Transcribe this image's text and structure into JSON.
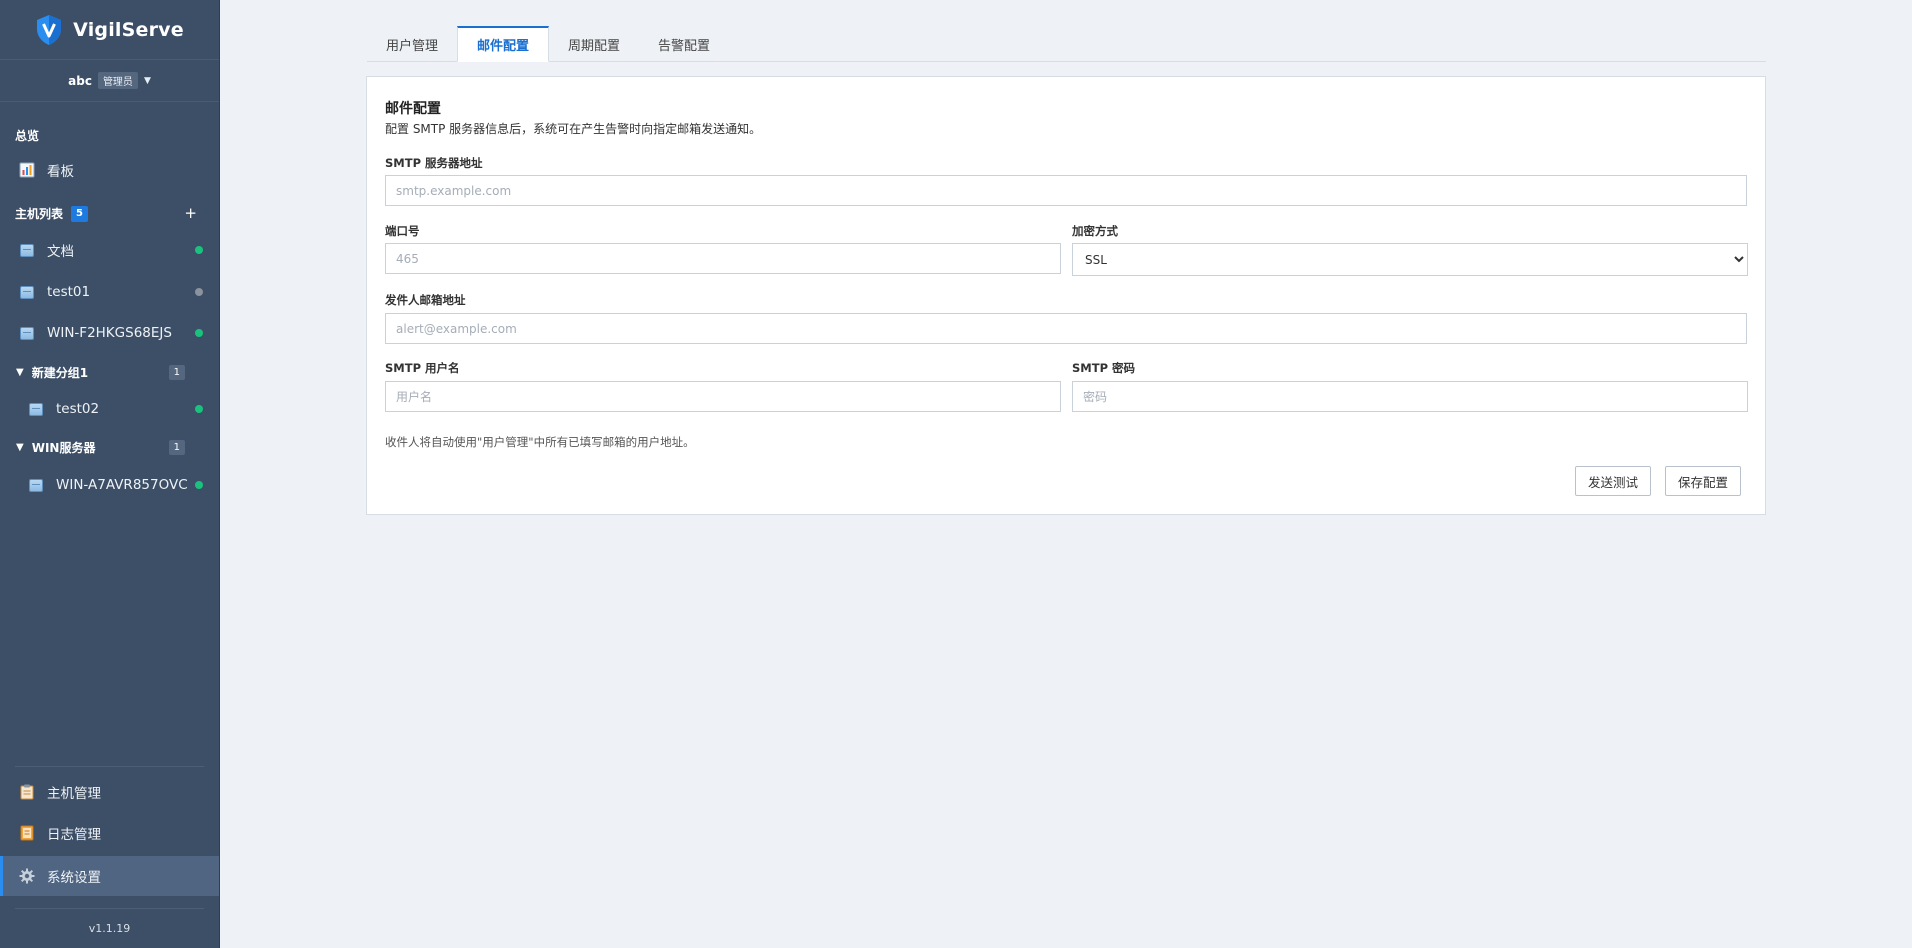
{
  "brand": {
    "name": "VigilServe",
    "color": "#2a8ef0"
  },
  "user": {
    "name": "abc",
    "role": "管理员",
    "menu_icon": "caret-down-icon"
  },
  "sidebar": {
    "overview_label": "总览",
    "dashboard": {
      "label": "看板",
      "icon": "chart-icon"
    },
    "host_list_label": "主机列表",
    "host_count": "5",
    "add_symbol": "+",
    "hosts": [
      {
        "name": "文档",
        "status": "online"
      },
      {
        "name": "test01",
        "status": "offline"
      },
      {
        "name": "WIN-F2HKGS68EJS",
        "status": "online"
      }
    ],
    "groups": [
      {
        "name": "新建分组1",
        "count": "1",
        "hosts": [
          {
            "name": "test02",
            "status": "online"
          }
        ]
      },
      {
        "name": "WIN服务器",
        "count": "1",
        "hosts": [
          {
            "name": "WIN-A7AVR857OVC",
            "status": "online"
          }
        ]
      }
    ],
    "bottom": [
      {
        "label": "主机管理",
        "icon": "clipboard-icon"
      },
      {
        "label": "日志管理",
        "icon": "log-book-icon"
      },
      {
        "label": "系统设置",
        "icon": "gear-icon",
        "active": true
      }
    ],
    "version": "v1.1.19"
  },
  "status_colors": {
    "online": "#19c37d",
    "offline": "#8a939e"
  },
  "tabs": [
    {
      "label": "用户管理",
      "active": false
    },
    {
      "label": "邮件配置",
      "active": true
    },
    {
      "label": "周期配置",
      "active": false
    },
    {
      "label": "告警配置",
      "active": false
    }
  ],
  "mail": {
    "title": "邮件配置",
    "description": "配置 SMTP 服务器信息后，系统可在产生告警时向指定邮箱发送通知。",
    "smtp_host": {
      "label": "SMTP 服务器地址",
      "placeholder": "smtp.example.com",
      "value": ""
    },
    "port": {
      "label": "端口号",
      "placeholder": "465",
      "value": ""
    },
    "encryption": {
      "label": "加密方式",
      "value": "SSL"
    },
    "sender": {
      "label": "发件人邮箱地址",
      "placeholder": "alert@example.com",
      "value": ""
    },
    "username": {
      "label": "SMTP 用户名",
      "placeholder": "用户名",
      "value": ""
    },
    "password": {
      "label": "SMTP 密码",
      "placeholder": "密码",
      "value": ""
    },
    "note": "收件人将自动使用\"用户管理\"中所有已填写邮箱的用户地址。",
    "test_button": "发送测试",
    "save_button": "保存配置"
  }
}
